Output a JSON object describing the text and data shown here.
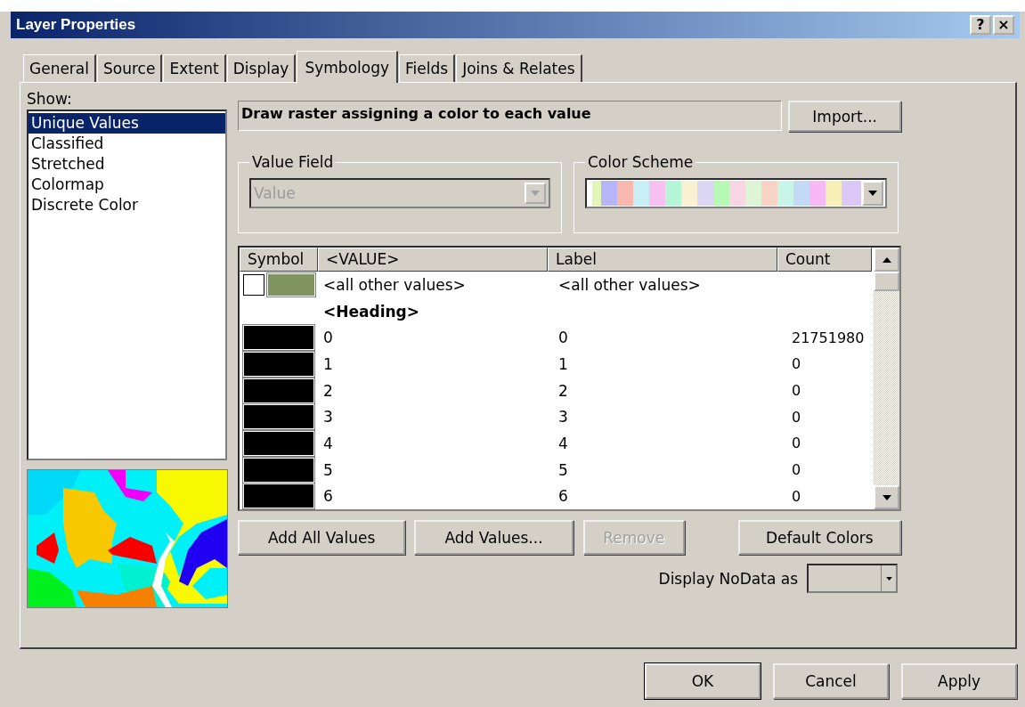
{
  "window": {
    "title": "Layer Properties",
    "help_button": "?",
    "close_button": "×"
  },
  "tabs": [
    {
      "label": "General",
      "selected": false
    },
    {
      "label": "Source",
      "selected": false
    },
    {
      "label": "Extent",
      "selected": false
    },
    {
      "label": "Display",
      "selected": false
    },
    {
      "label": "Symbology",
      "selected": true
    },
    {
      "label": "Fields",
      "selected": false
    },
    {
      "label": "Joins & Relates",
      "selected": false
    }
  ],
  "show": {
    "label": "Show:",
    "items": [
      {
        "label": "Unique Values",
        "selected": true
      },
      {
        "label": "Classified",
        "selected": false
      },
      {
        "label": "Stretched",
        "selected": false
      },
      {
        "label": "Colormap",
        "selected": false
      },
      {
        "label": "Discrete Color",
        "selected": false
      }
    ]
  },
  "description": "Draw raster assigning a color to each value",
  "import_button": "Import...",
  "value_field": {
    "title": "Value Field",
    "value": "Value",
    "disabled": true
  },
  "color_scheme": {
    "title": "Color Scheme"
  },
  "table": {
    "columns": [
      "Symbol",
      "<VALUE>",
      "Label",
      "Count"
    ],
    "rows": [
      {
        "kind": "other",
        "checked": false,
        "color": "#7f9460",
        "value": "<all other values>",
        "label": "<all other values>",
        "count": ""
      },
      {
        "kind": "heading",
        "value": "<Heading>"
      },
      {
        "kind": "value",
        "color": "#000000",
        "value": "0",
        "label": "0",
        "count": "21751980"
      },
      {
        "kind": "value",
        "color": "#000000",
        "value": "1",
        "label": "1",
        "count": "0"
      },
      {
        "kind": "value",
        "color": "#000000",
        "value": "2",
        "label": "2",
        "count": "0"
      },
      {
        "kind": "value",
        "color": "#000000",
        "value": "3",
        "label": "3",
        "count": "0"
      },
      {
        "kind": "value",
        "color": "#000000",
        "value": "4",
        "label": "4",
        "count": "0"
      },
      {
        "kind": "value",
        "color": "#000000",
        "value": "5",
        "label": "5",
        "count": "0"
      },
      {
        "kind": "value",
        "color": "#000000",
        "value": "6",
        "label": "6",
        "count": "0"
      }
    ]
  },
  "actions": [
    {
      "label": "Add All Values",
      "disabled": false
    },
    {
      "label": "Add Values...",
      "disabled": false
    },
    {
      "label": "Remove",
      "disabled": true
    },
    {
      "label": "Default Colors",
      "disabled": false
    }
  ],
  "nodata": {
    "label": "Display NoData as"
  },
  "dialog_buttons": [
    "OK",
    "Cancel",
    "Apply"
  ]
}
